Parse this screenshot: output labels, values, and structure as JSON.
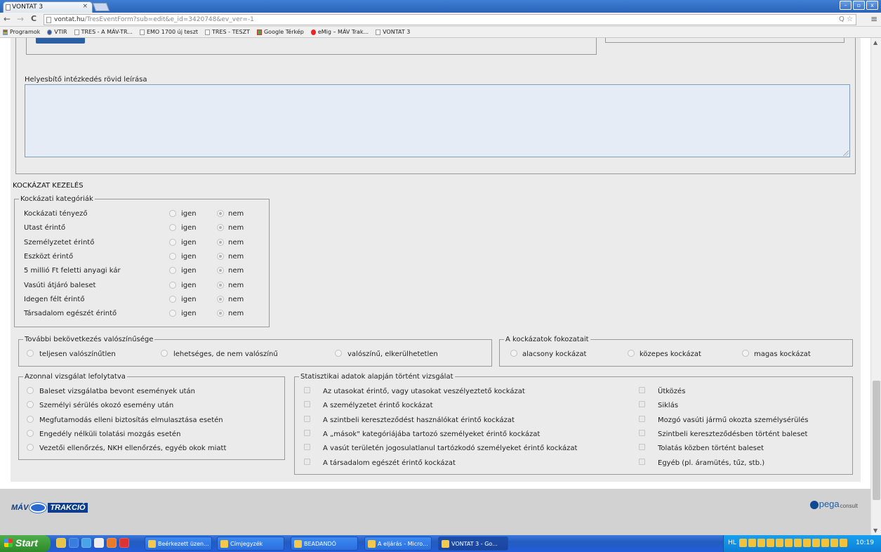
{
  "browser": {
    "tab_title": "VONTAT 3",
    "tab_close": "×",
    "url_host": "vontat.hu",
    "url_path": "/TresEventForm?sub=edit&e_id=3420748&ev_ver=-1",
    "nav_back": "←",
    "nav_forward": "→",
    "nav_reload": "C",
    "menu": "≡",
    "omnibox_right": "Q ☆",
    "window_controls": [
      "–",
      "▫",
      "x"
    ],
    "bookmarks": [
      "Programok",
      "VTIR",
      "TRES - A MÁV-TR...",
      "EMO 1700 új teszt",
      "TRES - TESZT",
      "Google Térkép",
      "eMig – MÁV Trak...",
      "VONTAT 3"
    ]
  },
  "form": {
    "description_label": "Helyesbítő intézkedés rövid leírása",
    "description_value": "",
    "section_title": "KOCKÁZAT KEZELÉS",
    "categories": {
      "legend": "Kockázati kategóriák",
      "yes_label": "igen",
      "no_label": "nem",
      "rows": [
        {
          "label": "Kockázati tényező",
          "value": "nem"
        },
        {
          "label": "Utast érintő",
          "value": "nem"
        },
        {
          "label": "Személyzetet érintő",
          "value": "nem"
        },
        {
          "label": "Eszközt érintő",
          "value": "nem"
        },
        {
          "label": "5 millió Ft feletti anyagi kár",
          "value": "nem"
        },
        {
          "label": "Vasúti átjáró baleset",
          "value": "nem"
        },
        {
          "label": "Idegen félt érintő",
          "value": "nem"
        },
        {
          "label": "Társadalom egészét érintő",
          "value": "nem"
        }
      ]
    },
    "likelihood": {
      "legend": "További bekövetkezés valószínűsége",
      "options": [
        "teljesen valószínűtlen",
        "lehetséges, de nem valószínű",
        "valószínű, elkerülhetetlen"
      ]
    },
    "risk_levels": {
      "legend": "A kockázatok fokozatait",
      "options": [
        "alacsony kockázat",
        "közepes kockázat",
        "magas kockázat"
      ]
    },
    "immediate": {
      "legend": "Azonnal vizsgálat lefolytatva",
      "options": [
        "Baleset vizsgálatba bevont események után",
        "Személyi sérülés okozó esemény után",
        "Megfutamodás elleni biztosítás elmulasztása esetén",
        "Engedély nélküli tolatási mozgás esetén",
        "Vezetői ellenőrzés, NKH ellenőrzés, egyéb okok miatt"
      ]
    },
    "statistics": {
      "legend": "Statisztikai adatok alapján történt vizsgálat",
      "left": [
        "Az utasokat érintő, vagy utasokat veszélyeztető kockázat",
        "A személyzetet érintő kockázat",
        "A szintbeli kereszteződést használókat érintő kockázat",
        "A „mások\" kategóriájába tartozó személyeket érintő kockázat",
        "A vasút területén jogosulatlanul tartózkodó személyeket érintő kockázat",
        "A társadalom egészét érintő kockázat"
      ],
      "right": [
        "Ütközés",
        "Siklás",
        "Mozgó vasúti jármű okozta személysérülés",
        "Szintbeli kereszteződésben történt baleset",
        "Tolatás közben történt baleset",
        "Egyéb (pl. áramütés, tűz, stb.)"
      ]
    }
  },
  "footer": {
    "mav_left": "MÁV",
    "mav_right": "TRAKCIÓ",
    "spega_main": "pega",
    "spega_sub": "consult"
  },
  "taskbar": {
    "start": "Start",
    "tasks": [
      "Beérkezett üzen...",
      "Címjegyzék",
      "BEADANDÓ",
      "A eljárás - Micro...",
      "VONTAT 3 - Go..."
    ],
    "tray_lang": "HL",
    "clock": "10:19"
  }
}
